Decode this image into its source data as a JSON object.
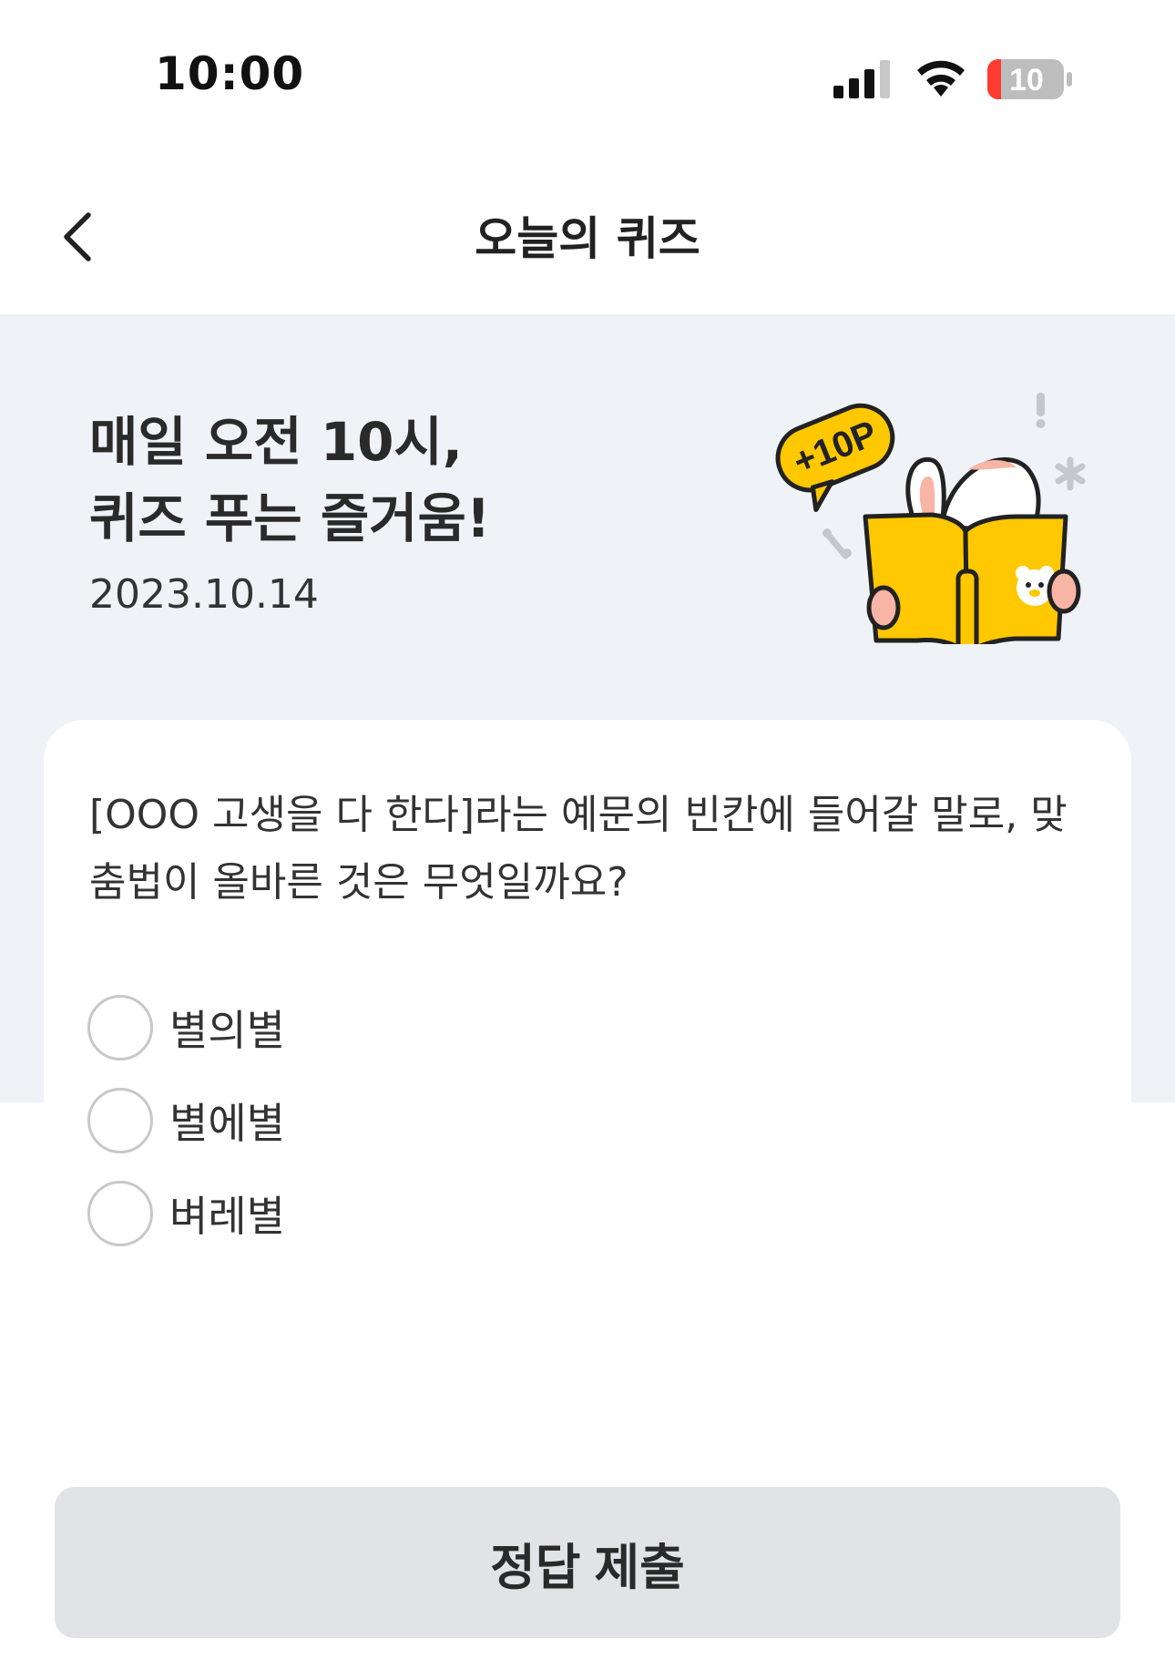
{
  "status_bar": {
    "time": "10:00",
    "battery_level": "10",
    "signal_icon": "cellular-signal-icon",
    "wifi_icon": "wifi-icon",
    "battery_icon": "battery-low-icon"
  },
  "nav": {
    "title": "오늘의 퀴즈",
    "back_icon": "chevron-left-icon"
  },
  "hero": {
    "title_line1": "매일 오전 10시,",
    "title_line2": "퀴즈 푸는 즐거움!",
    "date": "2023.10.14",
    "badge": "+10P",
    "illustration_icon": "bunny-reading-book-illustration"
  },
  "quiz": {
    "question_line1": "[OOO 고생을 다 한다]라는 예문의 빈칸에 들어갈 말로, 맞",
    "question_line2": "춤법이 올바른 것은 무엇일까요?",
    "options": [
      {
        "label": "별의별",
        "selected": false
      },
      {
        "label": "별에별",
        "selected": false
      },
      {
        "label": "벼레별",
        "selected": false
      }
    ]
  },
  "submit": {
    "label": "정답 제출"
  },
  "colors": {
    "hero_bg": "#eff2f6",
    "accent_yellow": "#ffc800",
    "button_bg": "#e1e3e6",
    "battery_red": "#ff3b30"
  }
}
